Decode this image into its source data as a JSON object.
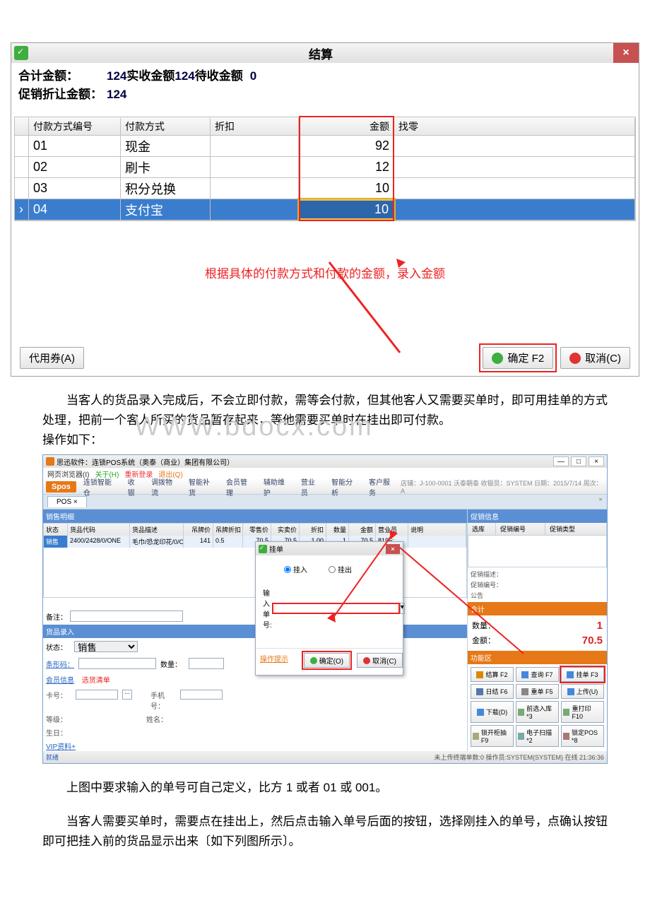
{
  "settlement": {
    "title": "结算",
    "labels": {
      "total": "合计金额：",
      "promo_discount": "促销折让金额：",
      "actual": "实收金额",
      "pending": "待收金额"
    },
    "total_value": "124",
    "promo_value": "124",
    "actual_value": "124",
    "pending_value": "0",
    "columns": {
      "code": "付款方式编号",
      "method": "付款方式",
      "discount": "折扣",
      "amount": "金额",
      "change": "找零"
    },
    "rows": [
      {
        "code": "01",
        "method": "现金",
        "amount": "92"
      },
      {
        "code": "02",
        "method": "刷卡",
        "amount": "12"
      },
      {
        "code": "03",
        "method": "积分兑换",
        "amount": "10"
      },
      {
        "code": "04",
        "method": "支付宝",
        "amount": "10",
        "selected": true
      }
    ],
    "annotation": "根据具体的付款方式和付款的金额，录入金额",
    "buttons": {
      "voucher": "代用券(A)",
      "ok": "确定 F2",
      "cancel": "取消(C)"
    }
  },
  "paragraphs": {
    "p1": "当客人的货品录入完成后，不会立即付款，需等会付款，但其他客人又需要买单时，即可用挂单的方式处理，把前一个客人所买的货品暂存起来，等他需要买单时在挂出即可付款。",
    "p1b": "操作如下：",
    "p2": "上图中要求输入的单号可自己定义，比方 1 或者 01 或 001。",
    "p3": "当客人需要买单时，需要点在挂出上，然后点击输入单号后面的按钮，选择刚挂入的单号，点确认按钮即可把挂入前的货品显示出来〔如下列图所示〕。"
  },
  "watermark": "WWW.bdocx.com",
  "pos": {
    "window_title": "思迅软件：连锁POS系统（奥泰（商业）集团有限公司）",
    "window_buttons": [
      "—",
      "□",
      "×"
    ],
    "menu": {
      "m1": "网页浏览器(I)",
      "m2": "关于(H)",
      "m3": "重新登录",
      "m4": "退出(Q)"
    },
    "logo": "Spos",
    "nav": [
      "连锁智能仓",
      "收银",
      "调拨物流",
      "智能补货",
      "会员管理",
      "辅助维护",
      "营业员",
      "智能分析",
      "客户服务"
    ],
    "info": "店铺：J-100-0001 沃泰朝泰   收银员：SYSTEM   日期：2015/7/14   周次：A",
    "tab_label": "POS",
    "sale_header": "销售明细",
    "sale_cols": [
      "状态",
      "货品代码",
      "货品描述",
      "吊牌价",
      "吊牌折扣",
      "零售价",
      "实卖价",
      "折扣",
      "数量",
      "金额",
      "营业员",
      "说明"
    ],
    "sale_row": {
      "status": "销售",
      "code": "2400/2428/0/ONE",
      "desc": "毛巾/恐龙印花/0/ONE",
      "tag": "141",
      "tagdisc": "0.5",
      "retail": "70.5",
      "real": "70.5",
      "disc": "1.00",
      "qty": "1",
      "amt": "70.5",
      "sales": "8196: ..."
    },
    "remarks_label": "备注：",
    "entry_header": "货品录入",
    "entry": {
      "status_lbl": "状态：",
      "status_val": "销售",
      "barcode_lbl": "条形码：",
      "qty_lbl": "数量："
    },
    "member_tabs": {
      "t1": "会员信息",
      "t2": "选货清单"
    },
    "member": {
      "card": "卡号：",
      "phone": "手机号：",
      "level": "等级：",
      "name": "姓名：",
      "birth": "生日：",
      "vip": "VIP资料+"
    },
    "hold": {
      "title": "挂单",
      "radio_in": "挂入",
      "radio_out": "挂出",
      "input_lbl": "输入单号:",
      "link": "操作提示",
      "ok": "确定(O)",
      "cancel": "取消(C)"
    },
    "right": {
      "promo_header": "促销信息",
      "promo_cols": [
        "选库",
        "促销编号",
        "促销类型"
      ],
      "promo_desc": "促销描述：",
      "promo_no": "促销编号：",
      "bulletin": "公告",
      "total_header": "合计",
      "qty_lbl": "数量：",
      "qty_val": "1",
      "amt_lbl": "金额：",
      "amt_val": "70.5",
      "fn_header": "功能区",
      "fn": [
        "结算 F2",
        "查询 F7",
        "挂单 F3",
        "日结 F6",
        "重单 F5",
        "上传(U)",
        "下载(D)",
        "前选入库 *3",
        "重打印 F10",
        "锁开柜抽 F9",
        "电子扫描 *2",
        "锁定POS *8"
      ]
    },
    "status": {
      "ready": "就绪",
      "right": "未上传终端单数:0   操作员:SYSTEM(SYSTEM)   在线   21:36:36"
    }
  }
}
